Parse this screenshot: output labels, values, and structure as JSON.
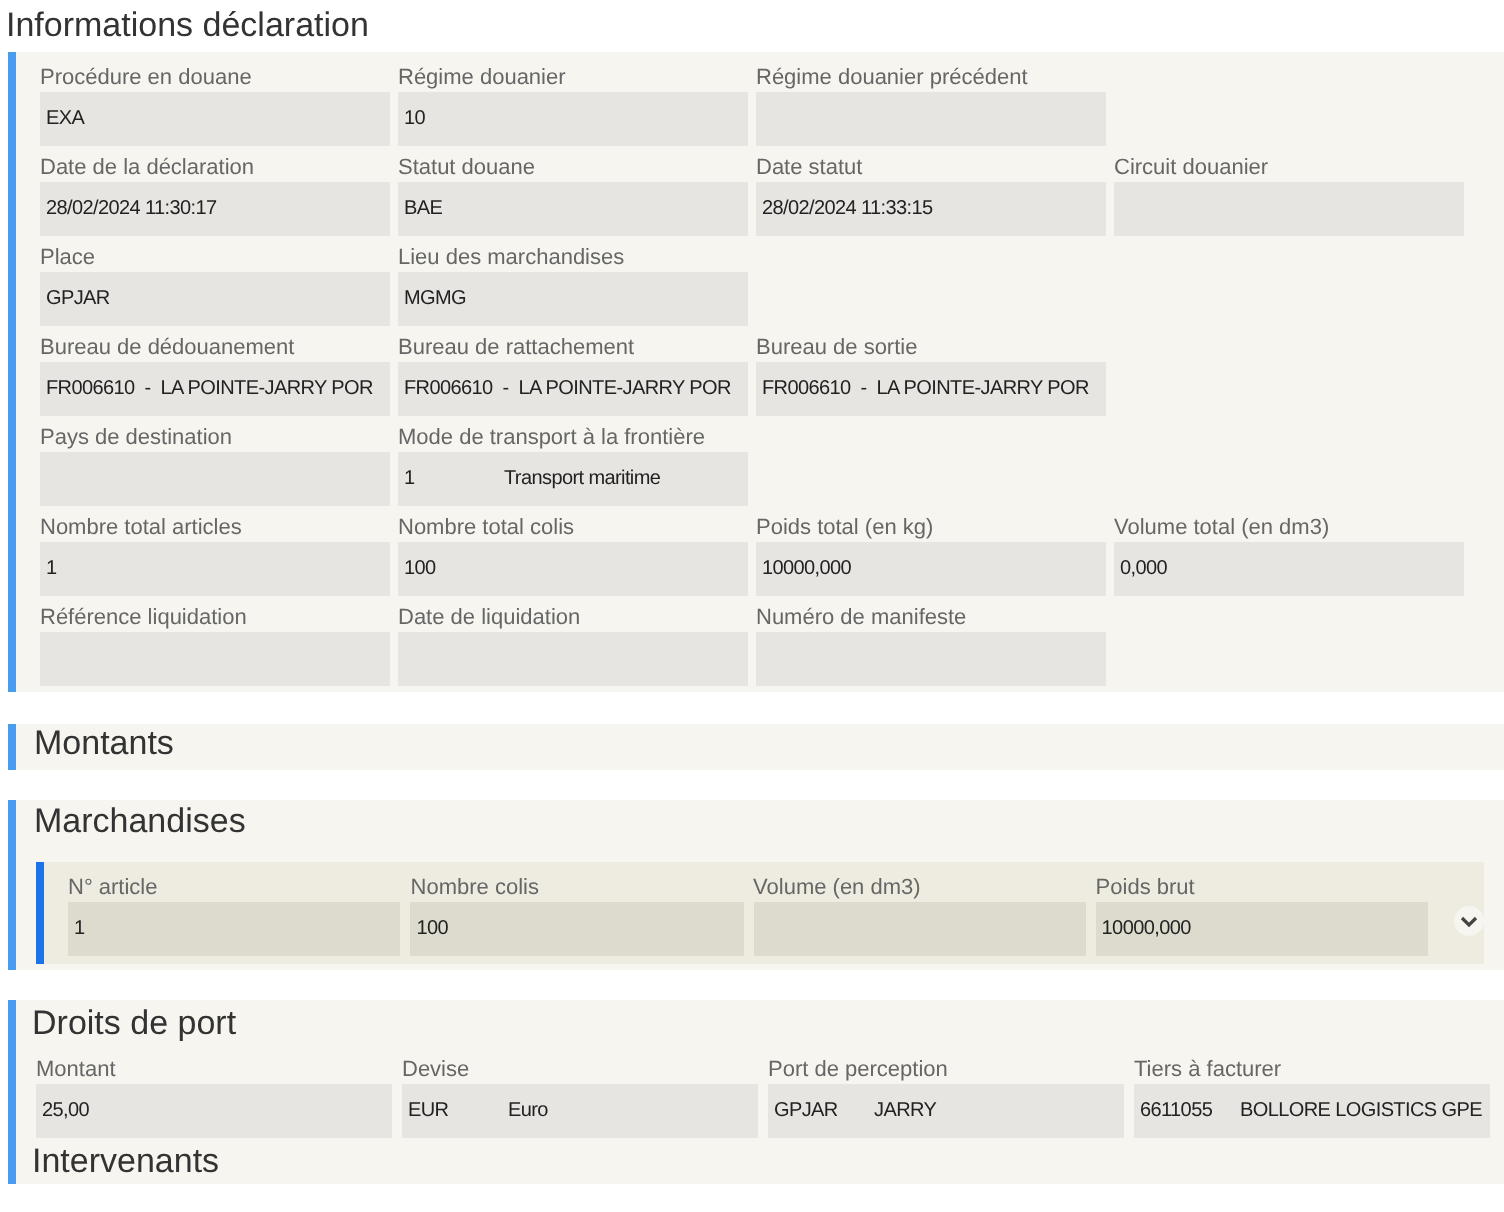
{
  "sections": [
    {
      "kind": "form",
      "title": "Informations déclaration",
      "rows": [
        [
          {
            "label": "Procédure en douane",
            "value": "EXA"
          },
          {
            "label": "Régime douanier",
            "value": "10"
          },
          {
            "label": "Régime douanier précédent"
          }
        ],
        [
          {
            "label": "Date de la déclaration",
            "value": "28/02/2024 11:30:17"
          },
          {
            "label": "Statut douane",
            "value": "BAE"
          },
          {
            "label": "Date statut",
            "value": "28/02/2024 11:33:15"
          },
          {
            "label": "Circuit douanier"
          }
        ],
        [
          {
            "label": "Place",
            "value": "GPJAR"
          },
          {
            "label": "Lieu des marchandises",
            "value": "MGMG"
          }
        ],
        [
          {
            "label": "Bureau de dédouanement",
            "value": "FR006610  -  LA POINTE-JARRY POR"
          },
          {
            "label": "Bureau de rattachement",
            "value": "FR006610  -  LA POINTE-JARRY POR"
          },
          {
            "label": "Bureau de sortie",
            "value": "FR006610  -  LA POINTE-JARRY POR"
          }
        ],
        [
          {
            "label": "Pays de destination"
          },
          {
            "label": "Mode de transport à la frontière",
            "value": "1",
            "value_2": "Transport maritime"
          }
        ],
        [
          {
            "label": "Nombre total articles",
            "value": "1"
          },
          {
            "label": "Nombre total colis",
            "value": "100"
          },
          {
            "label": "Poids total (en kg)",
            "value": "10000,000"
          },
          {
            "label": "Volume total (en dm3)",
            "value": "0,000"
          }
        ],
        [
          {
            "label": "Référence liquidation"
          },
          {
            "label": "Date de liquidation"
          },
          {
            "label": "Numéro de manifeste"
          }
        ]
      ]
    },
    {
      "kind": "collapsed",
      "title": "Montants"
    },
    {
      "kind": "items",
      "title": "Marchandises",
      "items": [
        {
          "expanded": false,
          "fields": [
            {
              "label": "N° article",
              "value": "1"
            },
            {
              "label": "Nombre colis",
              "value": "100"
            },
            {
              "label": "Volume (en dm3)"
            },
            {
              "label": "Poids brut",
              "value": "10000,000"
            }
          ]
        }
      ]
    },
    {
      "kind": "titled_form",
      "title": "Droits de port",
      "rows": [
        [
          {
            "label": "Montant",
            "value": "25,00"
          },
          {
            "label": "Devise",
            "value": "EUR",
            "value_2": "Euro"
          },
          {
            "label": "Port de perception",
            "value": "GPJAR",
            "value_2": "JARRY"
          },
          {
            "label": "Tiers à facturer",
            "value": "6611055",
            "value_2": "BOLLORE LOGISTICS GPE"
          }
        ]
      ]
    },
    {
      "kind": "heading",
      "title": "Intervenants"
    }
  ]
}
